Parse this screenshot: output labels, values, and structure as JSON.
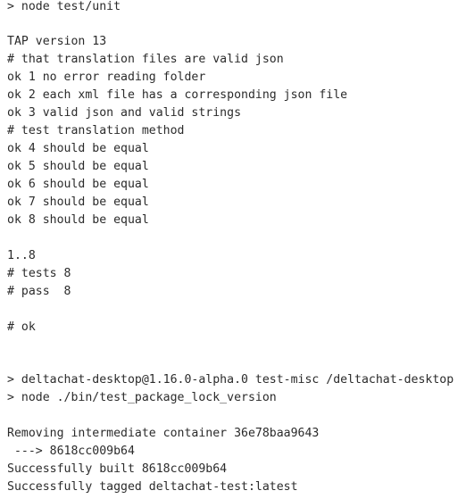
{
  "terminal": {
    "lines": [
      "> node test/unit",
      "",
      "TAP version 13",
      "# that translation files are valid json",
      "ok 1 no error reading folder",
      "ok 2 each xml file has a corresponding json file",
      "ok 3 valid json and valid strings",
      "# test translation method",
      "ok 4 should be equal",
      "ok 5 should be equal",
      "ok 6 should be equal",
      "ok 7 should be equal",
      "ok 8 should be equal",
      "",
      "1..8",
      "# tests 8",
      "# pass  8",
      "",
      "# ok",
      "",
      "",
      "> deltachat-desktop@1.16.0-alpha.0 test-misc /deltachat-desktop",
      "> node ./bin/test_package_lock_version",
      "",
      "Removing intermediate container 36e78baa9643",
      " ---> 8618cc009b64",
      "Successfully built 8618cc009b64",
      "Successfully tagged deltachat-test:latest"
    ]
  }
}
